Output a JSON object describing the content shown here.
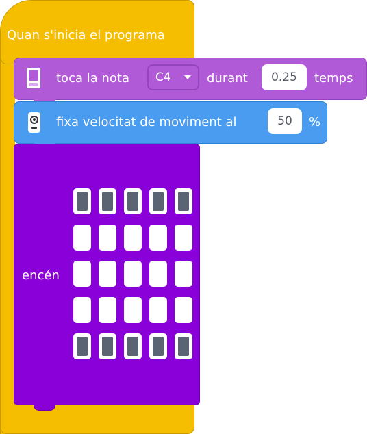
{
  "hat": {
    "title": "Quan s'inicia el programa"
  },
  "tone_block": {
    "label": "toca la nota",
    "note": "C4",
    "during_label": "durant",
    "beats": "0.25",
    "beats_unit": "temps"
  },
  "speed_block": {
    "label": "fixa velocitat de moviment al",
    "value": "50",
    "unit": "%"
  },
  "leds_block": {
    "label": "encén",
    "grid": [
      [
        1,
        1,
        1,
        1,
        1
      ],
      [
        0,
        0,
        0,
        0,
        0
      ],
      [
        0,
        0,
        0,
        0,
        0
      ],
      [
        0,
        0,
        0,
        0,
        0
      ],
      [
        1,
        1,
        1,
        1,
        1
      ]
    ]
  },
  "colors": {
    "hat": "#f6be00",
    "tone": "#b15ad8",
    "speed": "#4a9cf0",
    "leds": "#8a00d8",
    "led_on": "#5b6472",
    "led_off": "#ffffff"
  }
}
